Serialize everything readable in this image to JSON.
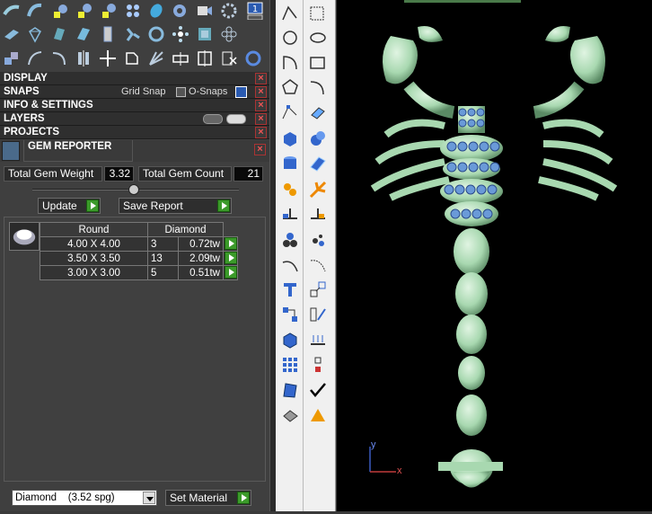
{
  "toolbar": {
    "row1": [
      "tentacle-icon",
      "arc-icon",
      "add-gem-icon",
      "gem-grid-icon",
      "gem-pave-icon",
      "pave-cluster-icon",
      "leaf-icon",
      "settings-icon",
      "camera-icon",
      "gear-icon",
      "info-icon"
    ],
    "row2": [
      "flat-sheet-icon",
      "diamond-icon",
      "blue-card-icon",
      "blue-sheet-icon",
      "blue-prong-icon",
      "ring-prong-icon",
      "flower-icon",
      "pave-grid-icon",
      "circle-ring-icon"
    ],
    "row3": [
      "cubes-icon",
      "curve-icon",
      "curve-offset-icon",
      "mirror-icon",
      "move-icon",
      "boolean-icon",
      "fan-icon",
      "bridge-icon",
      "split-icon",
      "cut-icon",
      "ring-icon"
    ]
  },
  "panels": {
    "display": "DISPLAY",
    "snaps": "SNAPS",
    "grid_snap": "Grid Snap",
    "o_snaps": "O-Snaps",
    "info_settings": "INFO & SETTINGS",
    "layers": "LAYERS",
    "projects": "PROJECTS"
  },
  "gem_reporter": {
    "title": "GEM REPORTER",
    "total_weight_label": "Total Gem Weight",
    "total_weight_value": "3.32",
    "total_count_label": "Total Gem Count",
    "total_count_value": "21",
    "update_label": "Update",
    "save_report_label": "Save Report",
    "table": {
      "headers": [
        "Round",
        "Diamond"
      ],
      "rows": [
        {
          "size": "4.00 X 4.00",
          "count": "3",
          "weight": "0.72tw"
        },
        {
          "size": "3.50 X 3.50",
          "count": "13",
          "weight": "2.09tw"
        },
        {
          "size": "3.00 X 3.00",
          "count": "5",
          "weight": "0.51tw"
        }
      ]
    }
  },
  "bottom": {
    "material_value": "Diamond    (3.52 spg)",
    "set_material_label": "Set Material"
  },
  "viewport": {
    "axis_y": "y",
    "axis_x": "x",
    "model_color": "#a8d8b0",
    "gem_color": "#6a9ad8"
  }
}
